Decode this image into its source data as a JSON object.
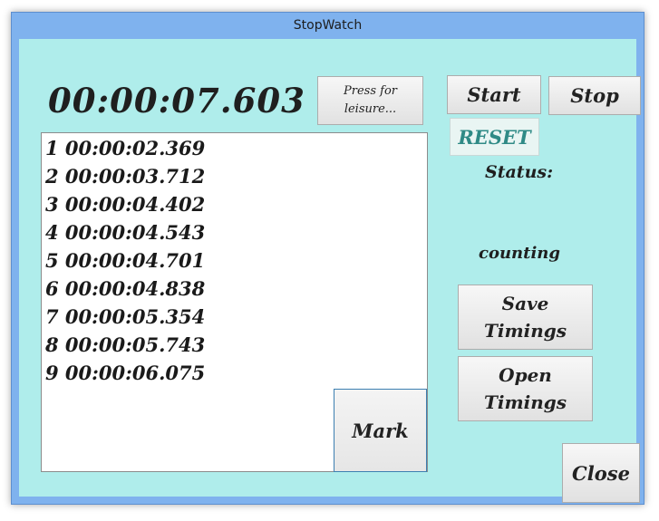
{
  "window": {
    "title": "StopWatch"
  },
  "clock": {
    "time": "00:00:07.603"
  },
  "buttons": {
    "leisure": "Press for\nleisure...",
    "start": "Start",
    "stop": "Stop",
    "reset": "RESET",
    "save": "Save\nTimings",
    "open": "Open\nTimings",
    "close": "Close",
    "mark": "Mark"
  },
  "status": {
    "label": "Status:",
    "value": "counting"
  },
  "laps": [
    "1 00:00:02.369",
    "2 00:00:03.712",
    "3 00:00:04.402",
    "4 00:00:04.543",
    "5 00:00:04.701",
    "6 00:00:04.838",
    "7 00:00:05.354",
    "8 00:00:05.743",
    "9 00:00:06.075"
  ]
}
